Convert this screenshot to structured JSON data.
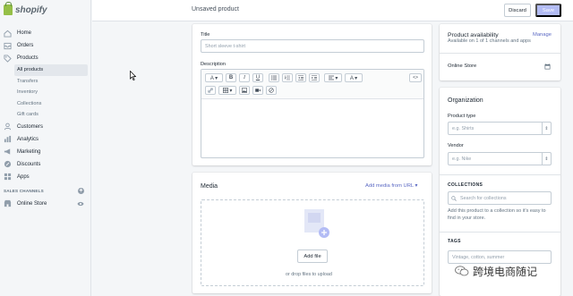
{
  "brand": {
    "name": "shopify"
  },
  "sidebar": {
    "items": [
      {
        "label": "Home",
        "icon": "home-icon"
      },
      {
        "label": "Orders",
        "icon": "orders-icon"
      },
      {
        "label": "Products",
        "icon": "tag-icon"
      }
    ],
    "product_subitems": [
      "All products",
      "Transfers",
      "Inventory",
      "Collections",
      "Gift cards"
    ],
    "items_after": [
      {
        "label": "Customers",
        "icon": "customers-icon"
      },
      {
        "label": "Analytics",
        "icon": "analytics-icon"
      },
      {
        "label": "Marketing",
        "icon": "marketing-icon"
      },
      {
        "label": "Discounts",
        "icon": "discounts-icon"
      },
      {
        "label": "Apps",
        "icon": "apps-icon"
      }
    ],
    "sales_channels_label": "SALES CHANNELS",
    "online_store_label": "Online Store"
  },
  "topbar": {
    "title": "Unsaved product",
    "discard_label": "Discard",
    "save_label": "Save"
  },
  "product": {
    "title_label": "Title",
    "title_placeholder": "Short sleeve t-shirt",
    "description_label": "Description"
  },
  "media": {
    "heading": "Media",
    "add_from_url": "Add media from URL ▾",
    "add_file": "Add file",
    "drop_text": "or drop files to upload"
  },
  "availability": {
    "heading": "Product availability",
    "manage": "Manage",
    "subtext": "Available on 1 of 1 channels and apps",
    "channel": "Online Store"
  },
  "organization": {
    "heading": "Organization",
    "product_type_label": "Product type",
    "product_type_placeholder": "e.g. Shirts",
    "vendor_label": "Vendor",
    "vendor_placeholder": "e.g. Nike",
    "collections_heading": "COLLECTIONS",
    "collections_placeholder": "Search for collections",
    "collections_help": "Add this product to a collection so it's easy to find in your store.",
    "tags_heading": "TAGS",
    "tags_placeholder": "Vintage, cotton, summer"
  },
  "watermark": {
    "text": "跨境电商随记"
  },
  "colors": {
    "accent": "#5c6ac4",
    "save_disabled": "#b3bcf5",
    "brand_green": "#95bf47"
  }
}
